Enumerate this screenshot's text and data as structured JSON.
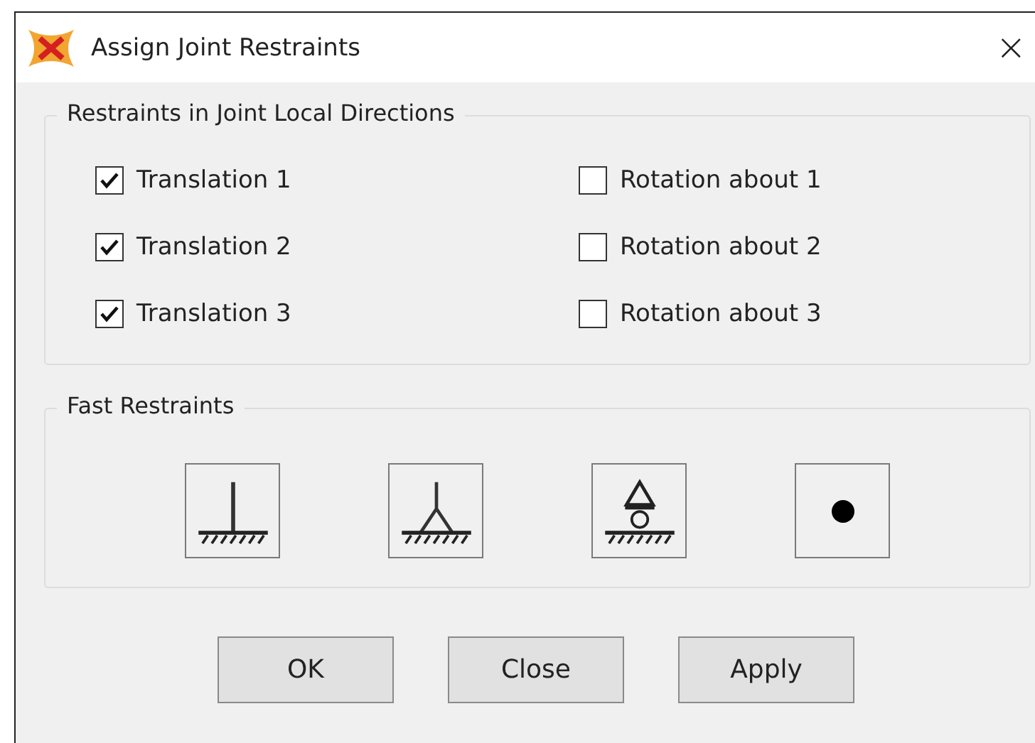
{
  "window": {
    "title": "Assign Joint Restraints",
    "close": "×"
  },
  "restraints_group": {
    "title": "Restraints in Joint Local Directions",
    "checkboxes": [
      {
        "label": "Translation 1",
        "checked": true
      },
      {
        "label": "Rotation about 1",
        "checked": false
      },
      {
        "label": "Translation 2",
        "checked": true
      },
      {
        "label": "Rotation about 2",
        "checked": false
      },
      {
        "label": "Translation 3",
        "checked": true
      },
      {
        "label": "Rotation about 3",
        "checked": false
      }
    ]
  },
  "fast_restraints_group": {
    "title": "Fast Restraints",
    "buttons": [
      {
        "kind": "fixed"
      },
      {
        "kind": "pinned"
      },
      {
        "kind": "roller"
      },
      {
        "kind": "free"
      }
    ]
  },
  "buttons": [
    "OK",
    "Close",
    "Apply"
  ]
}
